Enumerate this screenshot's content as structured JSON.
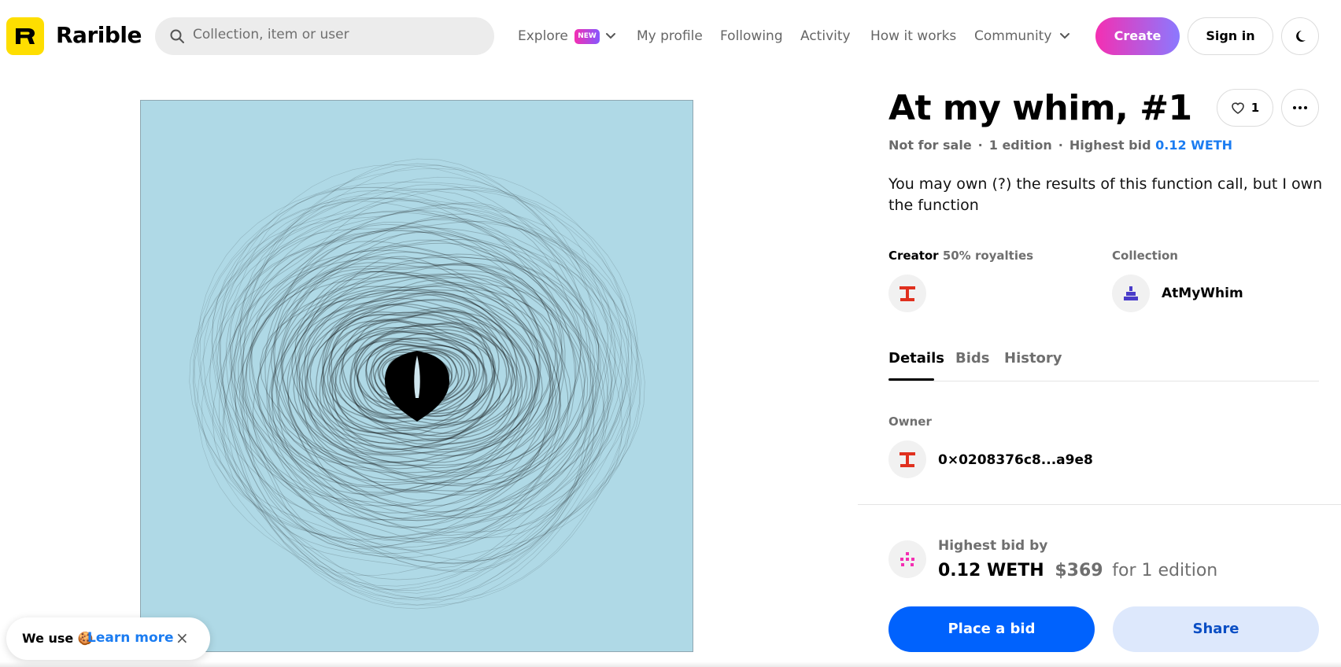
{
  "header": {
    "brand": "Rarible",
    "search_placeholder": "Collection, item or user",
    "nav": {
      "explore": "Explore",
      "explore_badge": "NEW",
      "my_profile": "My profile",
      "following": "Following",
      "activity": "Activity",
      "how_it_works": "How it works",
      "community": "Community"
    },
    "create_label": "Create",
    "signin_label": "Sign in"
  },
  "item": {
    "title": "At my whim, #1",
    "likes": "1",
    "sale_status": "Not for sale",
    "editions": "1 edition",
    "highest_bid_label": "Highest bid",
    "highest_bid_value": "0.12 WETH",
    "description": "You may own (?) the results of this function call, but I own the function",
    "creator_label": "Creator",
    "royalties": "50% royalties",
    "collection_label": "Collection",
    "collection_name": "AtMyWhim"
  },
  "tabs": [
    "Details",
    "Bids",
    "History"
  ],
  "details": {
    "owner_label": "Owner",
    "owner_address": "0×0208376c8...a9e8"
  },
  "bid_panel": {
    "label": "Highest bid by",
    "amount": "0.12 WETH",
    "usd": "$369",
    "for_text": "for 1 edition",
    "place_bid_label": "Place a bid",
    "share_label": "Share"
  },
  "cookie": {
    "text": "We use 🍪",
    "link": "Learn more",
    "close": "×"
  },
  "colors": {
    "accent_blue": "#0062fd",
    "link_blue": "#1b7cf1",
    "brand_yellow": "#fede00",
    "artwork_bg": "#afd9e6",
    "creator_red": "#e0301e"
  }
}
